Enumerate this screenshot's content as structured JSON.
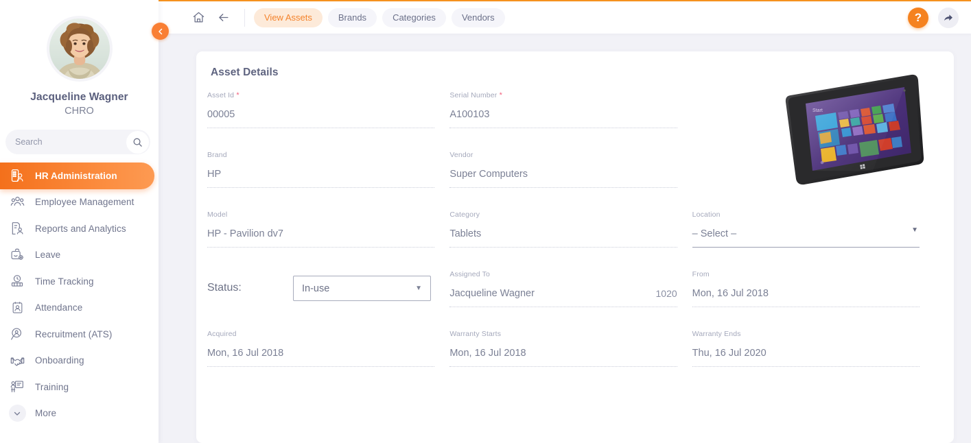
{
  "sidebar": {
    "user": {
      "name": "Jacqueline Wagner",
      "role": "CHRO",
      "avatar_icon": "user-avatar-photo"
    },
    "search": {
      "placeholder": "Search",
      "value": "",
      "icon": "search-icon"
    },
    "collapse_button": {
      "icon": "chevron-left-icon"
    },
    "items": [
      {
        "label": "HR Administration",
        "icon": "hr-administration-icon",
        "active": true
      },
      {
        "label": "Employee Management",
        "icon": "employee-management-icon",
        "active": false
      },
      {
        "label": "Reports and Analytics",
        "icon": "reports-analytics-icon",
        "active": false
      },
      {
        "label": "Leave",
        "icon": "leave-icon",
        "active": false
      },
      {
        "label": "Time Tracking",
        "icon": "time-tracking-icon",
        "active": false
      },
      {
        "label": "Attendance",
        "icon": "attendance-icon",
        "active": false
      },
      {
        "label": "Recruitment (ATS)",
        "icon": "recruitment-icon",
        "active": false
      },
      {
        "label": "Onboarding",
        "icon": "onboarding-icon",
        "active": false
      },
      {
        "label": "Training",
        "icon": "training-icon",
        "active": false
      },
      {
        "label": "More",
        "icon": "chevron-down-icon",
        "active": false
      }
    ]
  },
  "topbar": {
    "home_icon": "home-icon",
    "back_icon": "arrow-left-icon",
    "tabs": [
      {
        "label": "View Assets",
        "active": true
      },
      {
        "label": "Brands",
        "active": false
      },
      {
        "label": "Categories",
        "active": false
      },
      {
        "label": "Vendors",
        "active": false
      }
    ],
    "help_label": "?",
    "help_icon": "help-question-icon",
    "share_icon": "share-arrow-icon"
  },
  "main": {
    "card_title": "Asset Details",
    "device_image_alt": "hp-tablet-device-photo",
    "fields": {
      "asset_id": {
        "label": "Asset Id",
        "required": true,
        "value": "00005"
      },
      "serial_number": {
        "label": "Serial Number",
        "required": true,
        "value": "A100103"
      },
      "brand": {
        "label": "Brand",
        "required": false,
        "value": "HP"
      },
      "vendor": {
        "label": "Vendor",
        "required": false,
        "value": "Super Computers"
      },
      "model": {
        "label": "Model",
        "required": false,
        "value": "HP - Pavilion dv7"
      },
      "category": {
        "label": "Category",
        "required": false,
        "value": "Tablets"
      },
      "location": {
        "label": "Location",
        "required": false,
        "value": "– Select –",
        "is_select": true,
        "caret": "▼"
      },
      "status": {
        "label": "Status:",
        "value": "In-use",
        "is_select": true,
        "caret": "▼"
      },
      "assigned_to": {
        "label": "Assigned To",
        "required": false,
        "value": "Jacqueline Wagner",
        "employee_id": "1020"
      },
      "from": {
        "label": "From",
        "required": false,
        "value": "Mon, 16 Jul 2018"
      },
      "acquired": {
        "label": "Acquired",
        "required": false,
        "value": "Mon, 16 Jul 2018"
      },
      "warranty_starts": {
        "label": "Warranty Starts",
        "required": false,
        "value": "Mon, 16 Jul 2018"
      },
      "warranty_ends": {
        "label": "Warranty Ends",
        "required": false,
        "value": "Thu, 16 Jul 2020"
      }
    }
  },
  "colors": {
    "accent_orange": "#f5821f",
    "accent_orange_light": "#fdead9",
    "required_red": "#f2607d",
    "text_muted": "#7b8095",
    "label_gray": "#a4a8bb",
    "page_bg": "#f2f2f7"
  }
}
